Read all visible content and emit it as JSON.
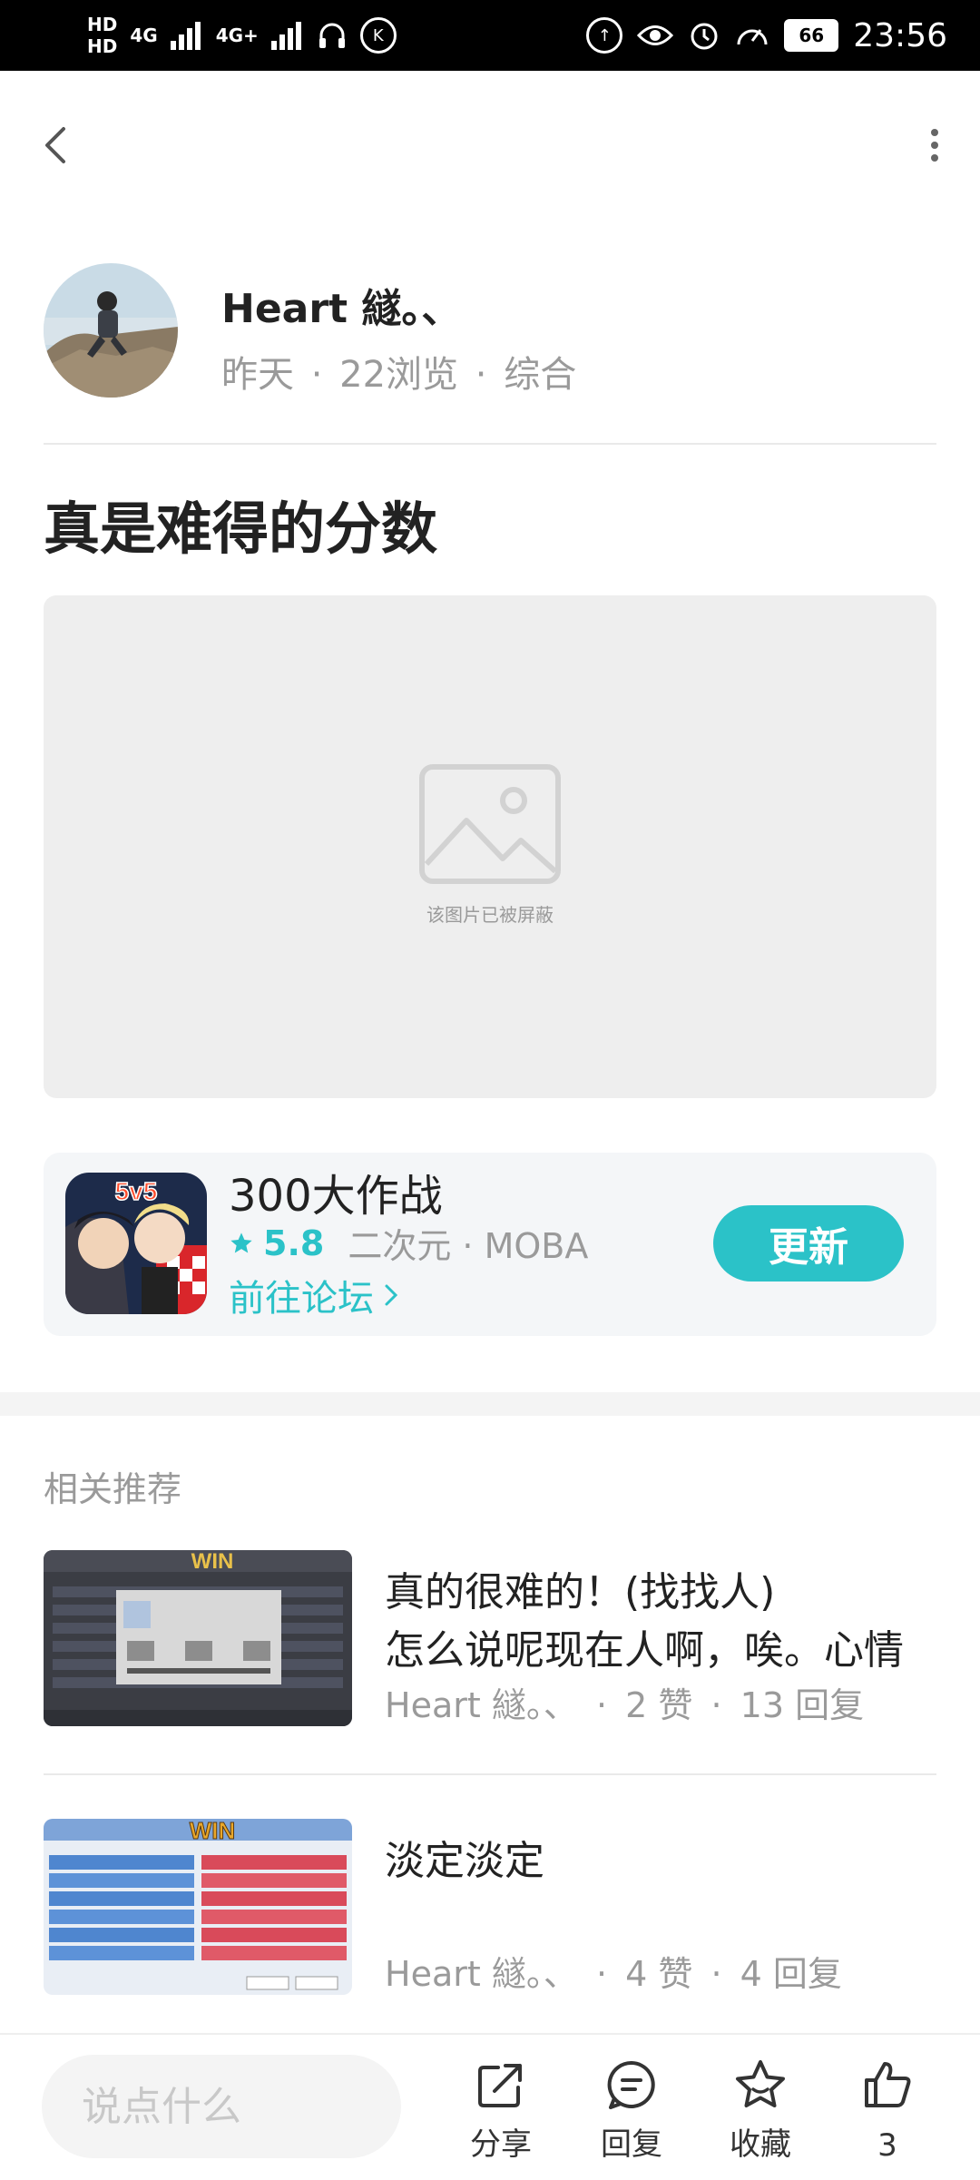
{
  "status_bar": {
    "hd1": "HD",
    "hd2": "HD",
    "net1": "4G",
    "net2": "4G+",
    "battery": "66",
    "time": "23:56",
    "colors": {
      "background": "#000000",
      "text": "#ffffff"
    }
  },
  "nav": {
    "back_icon": "chevron-left-icon",
    "more_icon": "more-vertical-icon"
  },
  "author": {
    "name": "Heart 繸。、",
    "time": "昨天",
    "views": "22浏览",
    "category": "综合",
    "separator": "·"
  },
  "post": {
    "title": "真是难得的分数",
    "blocked_image_text": "该图片已被屏蔽"
  },
  "game": {
    "name": "300大作战",
    "rating": "5.8",
    "tags": "二次元 · MOBA",
    "forum_link": "前往论坛",
    "update_button": "更新",
    "icon_badge": "5v5",
    "accent_color": "#2bc2c8"
  },
  "related": {
    "header": "相关推荐",
    "items": [
      {
        "title": "真的很难的！(找找人)",
        "snippet": "怎么说呢现在人啊，唉。心情",
        "author": "Heart 繸。、",
        "likes": "2 赞",
        "replies": "13 回复",
        "thumb_banner": "WIN"
      },
      {
        "title": "淡定淡定",
        "snippet": "",
        "author": "Heart 繸。、",
        "likes": "4 赞",
        "replies": "4 回复",
        "thumb_banner": "WIN"
      }
    ]
  },
  "bottom_bar": {
    "input_placeholder": "说点什么",
    "share": "分享",
    "reply": "回复",
    "favorite": "收藏",
    "like_count": "3"
  }
}
